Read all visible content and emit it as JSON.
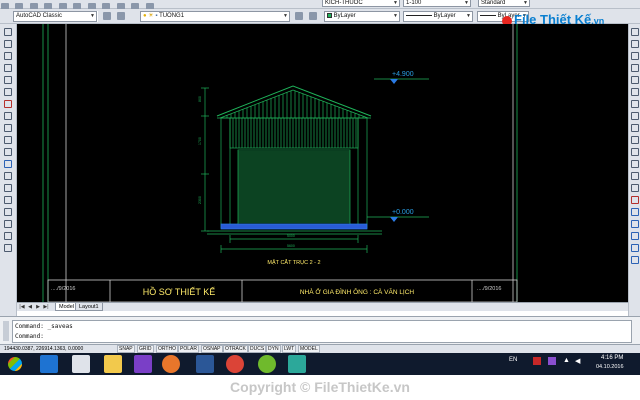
{
  "toolbar": {
    "workspace": "AutoCAD Classic",
    "layer": "TUONG1",
    "dim_style": "KICH-THUOC",
    "text_style": "1-100",
    "table_style": "Standard",
    "color": "ByLayer",
    "linetype": "ByLayer",
    "lineweight": "ByLayer"
  },
  "logo": {
    "brand": "File Thiết Kế",
    "ext": ".vn"
  },
  "drawing": {
    "level_top": "+4.900",
    "level_ground": "+0.000",
    "section_title": "MẶT CẮT TRỤC 2 - 2",
    "dim_inner": "5000",
    "dim_outer": "5600",
    "dim_side_top": "800",
    "dim_side_mid": "1700",
    "dim_side_low": "2300",
    "title_block_left": "HỒ SƠ THIẾT KẾ",
    "title_block_main": "NHÀ Ở GIA ĐÌNH ÔNG : CÀ VĂN LỊCH",
    "date_left": "..../9/2016",
    "date_right": "..../9/2016"
  },
  "tabs": {
    "model": "Model",
    "layout1": "Layout1"
  },
  "command": {
    "line1": "Command: _saveas",
    "line2": "Command:"
  },
  "status": {
    "coords": "194430.0387, 226914.1363, 0.0000",
    "buttons": [
      "SNAP",
      "GRID",
      "ORTHO",
      "POLAR",
      "OSNAP",
      "OTRACK",
      "DUCS",
      "DYN",
      "LWT",
      "MODEL"
    ]
  },
  "taskbar": {
    "lang": "EN",
    "time": "4:16 PM",
    "date": "04.10.2016"
  },
  "copyright": "Copyright © FileThietKe.vn",
  "colors": {
    "canvas": "#000000",
    "line": "#1fb35a",
    "accent": "#2a7be4",
    "title_text": "#ffeb6a"
  }
}
